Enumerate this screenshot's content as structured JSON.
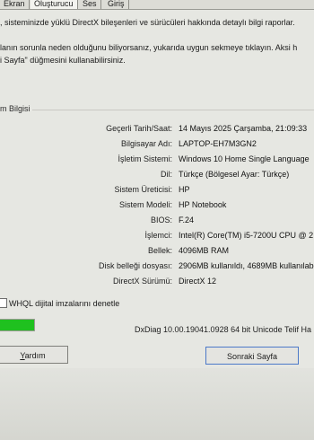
{
  "tabs": [
    "Ekran",
    "Oluşturucu",
    "Ses",
    "Giriş"
  ],
  "intro_lines": [
    ", sisteminizde yüklü DirectX bileşenleri ve sürücüleri hakkında detaylı bilgi raporlar.",
    "",
    "lanın sorunla neden olduğunu biliyorsanız, yukarıda uygun sekmeye tıklayın. Aksi h",
    "i Sayfa\" düğmesini kullanabilirsiniz."
  ],
  "group_title": "m Bilgisi",
  "system_info": [
    {
      "label": "Geçerli Tarih/Saat:",
      "value": "14 Mayıs 2025 Çarşamba, 21:09:33"
    },
    {
      "label": "Bilgisayar Adı:",
      "value": "LAPTOP-EH7M3GN2"
    },
    {
      "label": "İşletim Sistemi:",
      "value": "Windows 10 Home Single Language"
    },
    {
      "label": "Dil:",
      "value": "Türkçe (Bölgesel Ayar: Türkçe)"
    },
    {
      "label": "Sistem Üreticisi:",
      "value": "HP"
    },
    {
      "label": "Sistem Modeli:",
      "value": "HP Notebook"
    },
    {
      "label": "BIOS:",
      "value": "F.24"
    },
    {
      "label": "İşlemci:",
      "value": "Intel(R) Core(TM) i5-7200U CPU @ 2"
    },
    {
      "label": "Bellek:",
      "value": "4096MB RAM"
    },
    {
      "label": "Disk belleği dosyası:",
      "value": "2906MB kullanıldı, 4689MB kullanılabil"
    },
    {
      "label": "DirectX Sürümü:",
      "value": "DirectX 12"
    }
  ],
  "whql_label": "WHQL dijital imzalarını denetle",
  "progress_percent": 100,
  "version_text": "DxDiag 10.00.19041.0928 64 bit Unicode  Telif Ha",
  "buttons": {
    "help_first": "Y",
    "help_rest": "ardım",
    "next": "Sonraki Sayfa"
  },
  "colors": {
    "progress": "#1fc11f",
    "focus_border": "#4c79c8"
  }
}
